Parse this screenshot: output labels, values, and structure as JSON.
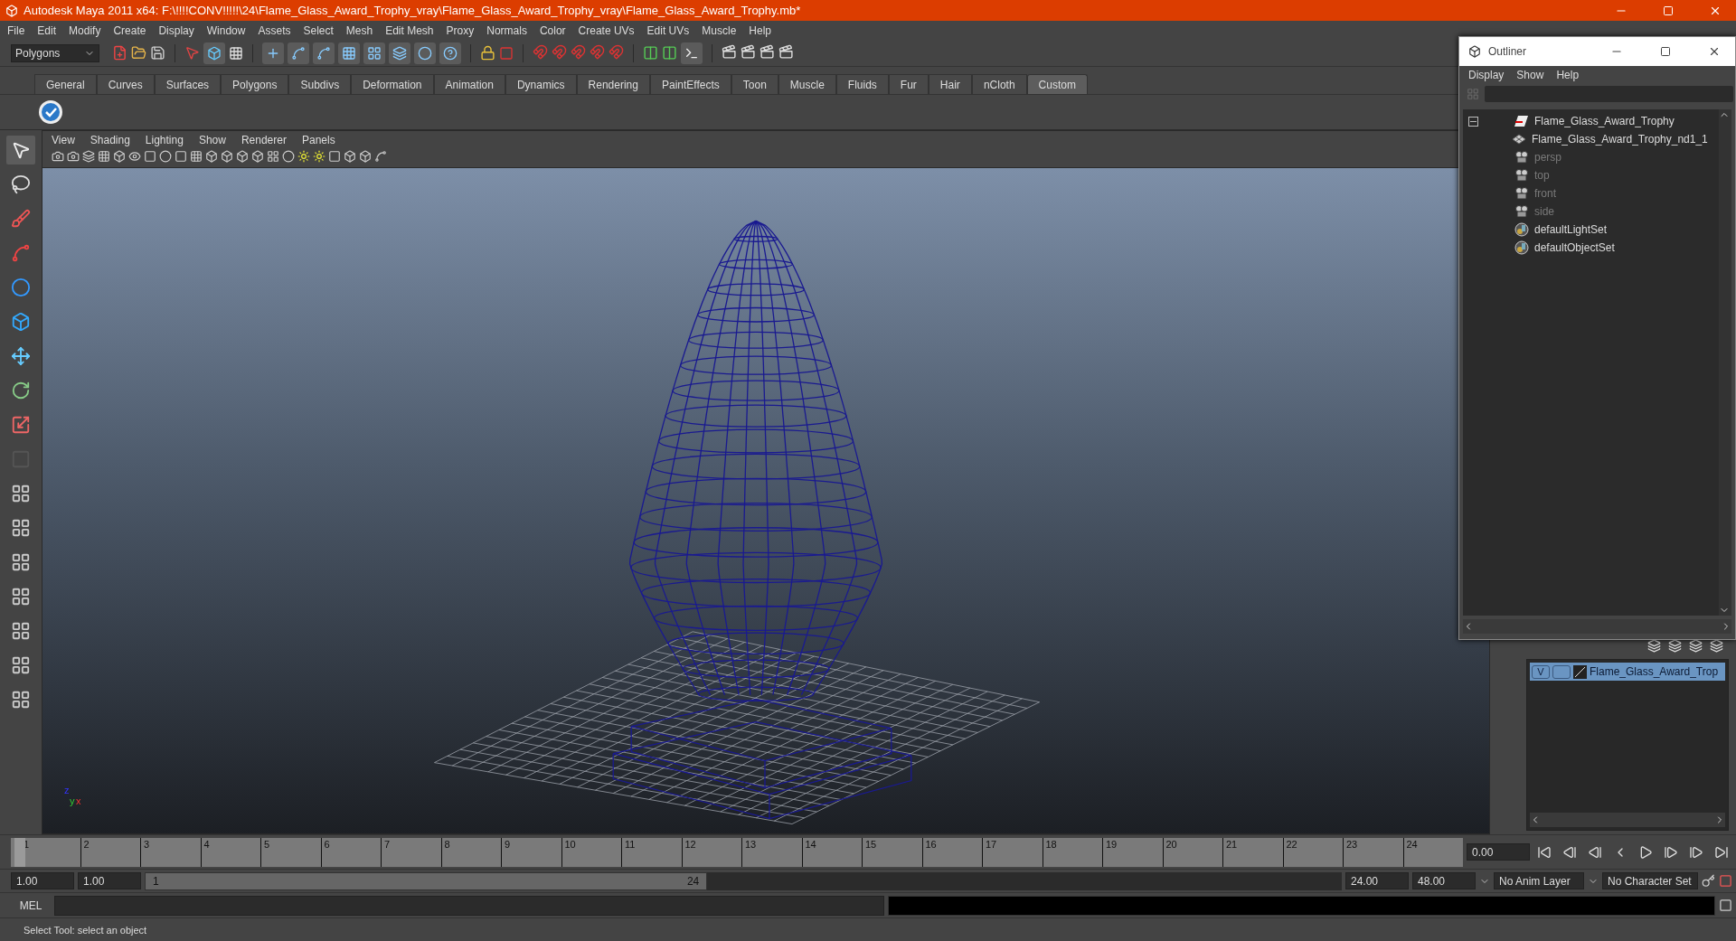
{
  "window": {
    "title": "Autodesk Maya 2011 x64: F:\\!!!!CONV!!!!!\\24\\Flame_Glass_Award_Trophy_vray\\Flame_Glass_Award_Trophy_vray\\Flame_Glass_Award_Trophy.mb*"
  },
  "menu_bar": [
    "File",
    "Edit",
    "Modify",
    "Create",
    "Display",
    "Window",
    "Assets",
    "Select",
    "Mesh",
    "Edit Mesh",
    "Proxy",
    "Normals",
    "Color",
    "Create UVs",
    "Edit UVs",
    "Muscle",
    "Help"
  ],
  "toolbar": {
    "mode_dropdown": "Polygons"
  },
  "shelf": {
    "tabs": [
      {
        "label": "General",
        "selected": false
      },
      {
        "label": "Curves",
        "selected": false
      },
      {
        "label": "Surfaces",
        "selected": false
      },
      {
        "label": "Polygons",
        "selected": false
      },
      {
        "label": "Subdivs",
        "selected": false
      },
      {
        "label": "Deformation",
        "selected": false
      },
      {
        "label": "Animation",
        "selected": false
      },
      {
        "label": "Dynamics",
        "selected": false
      },
      {
        "label": "Rendering",
        "selected": false
      },
      {
        "label": "PaintEffects",
        "selected": false
      },
      {
        "label": "Toon",
        "selected": false
      },
      {
        "label": "Muscle",
        "selected": false
      },
      {
        "label": "Fluids",
        "selected": false
      },
      {
        "label": "Fur",
        "selected": false
      },
      {
        "label": "Hair",
        "selected": false
      },
      {
        "label": "nCloth",
        "selected": false
      },
      {
        "label": "Custom",
        "selected": true
      }
    ]
  },
  "viewport": {
    "menu": [
      "View",
      "Shading",
      "Lighting",
      "Show",
      "Renderer",
      "Panels"
    ],
    "axis": {
      "z": "z",
      "y": "y",
      "x": "x"
    }
  },
  "timeline": {
    "ticks": [
      "1",
      "2",
      "3",
      "4",
      "5",
      "6",
      "7",
      "8",
      "9",
      "10",
      "11",
      "12",
      "13",
      "14",
      "15",
      "16",
      "17",
      "18",
      "19",
      "20",
      "21",
      "22",
      "23",
      "24"
    ],
    "current_time": "0.00",
    "level": 0
  },
  "range": {
    "start": "1.00",
    "playback_start": "1.00",
    "slider_start": "1",
    "slider_end": "24",
    "playback_end": "24.00",
    "end": "48.00",
    "anim_layer": "No Anim Layer",
    "character_set": "No Character Set",
    "level": 0.47
  },
  "command_line": {
    "label": "MEL"
  },
  "help_line": "Select Tool: select an object",
  "outliner": {
    "title": "Outliner",
    "menu": [
      "Display",
      "Show",
      "Help"
    ],
    "items": [
      {
        "name": "Flame_Glass_Award_Trophy",
        "kind": "transform",
        "dimmed": false,
        "expanded": true,
        "children": [
          {
            "name": "Flame_Glass_Award_Trophy_nd1_1",
            "kind": "mesh",
            "dimmed": false
          }
        ]
      },
      {
        "name": "persp",
        "kind": "camera",
        "dimmed": true
      },
      {
        "name": "top",
        "kind": "camera",
        "dimmed": true
      },
      {
        "name": "front",
        "kind": "camera",
        "dimmed": true
      },
      {
        "name": "side",
        "kind": "camera",
        "dimmed": true
      },
      {
        "name": "defaultLightSet",
        "kind": "set",
        "dimmed": false
      },
      {
        "name": "defaultObjectSet",
        "kind": "set",
        "dimmed": false
      }
    ]
  },
  "layers": [
    {
      "name": "Flame_Glass_Award_Trop",
      "visible_label": "V",
      "selected": true
    }
  ]
}
